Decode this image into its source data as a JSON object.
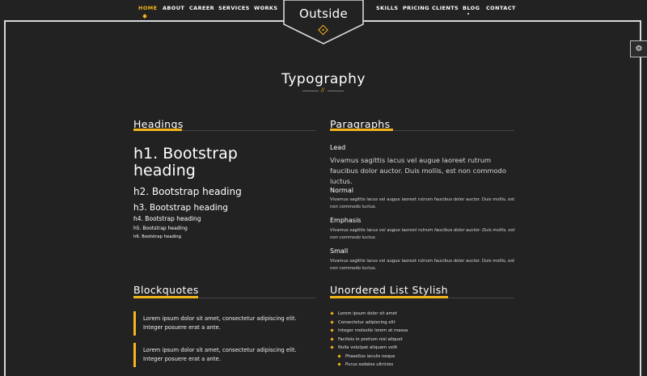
{
  "nav": {
    "left": [
      "HOME",
      "ABOUT",
      "CAREER",
      "SERVICES",
      "WORKS"
    ],
    "right": [
      "SKILLS",
      "PRICING",
      "CLIENTS",
      "BLOG",
      "CONTACT"
    ]
  },
  "logo": {
    "text": "Outside"
  },
  "settings_icon": "gear-icon",
  "page": {
    "title": "Typography",
    "separator": "//"
  },
  "headings_section": {
    "title": "Headings",
    "h1": "h1. Bootstrap heading",
    "h2": "h2. Bootstrap heading",
    "h3": "h3. Bootstrap heading",
    "h4": "h4. Bootstrap heading",
    "h5": "h5. Bootstrap heading",
    "h6": "h6. Bootstrap heading"
  },
  "paragraphs_section": {
    "title": "Paragraphs",
    "lead_label": "Lead",
    "lead_text": "Vivamus sagittis lacus vel augue laoreet rutrum faucibus dolor auctor. Duis mollis, est non commodo luctus.",
    "normal_label": "Normal",
    "normal_text": "Vivamus sagittis lacus vel augue laoreet rutrum faucibus dolor auctor. Duis mollis, est non commodo luctus.",
    "emphasis_label": "Emphasis",
    "emphasis_text": "Vivamus sagittis lacus vel augue laoreet rutrum faucibus dolor auctor. Duis mollis, est non commodo luctus.",
    "small_label": "Small",
    "small_text": "Vivamus sagittis lacus vel augue laoreet rutrum faucibus dolor auctor. Duis mollis, est non commodo luctus."
  },
  "blockquotes_section": {
    "title": "Blockquotes",
    "quotes": [
      "Lorem ipsum dolor sit amet, consectetur adipiscing elit. Integer posuere erat a ante.",
      "Lorem ipsum dolor sit amet, consectetur adipiscing elit. Integer posuere erat a ante."
    ]
  },
  "list_section": {
    "title": "Unordered List Stylish",
    "items": [
      "Lorem ipsum dolor sit amet",
      "Consectetur adipiscing elit",
      "Integer molestie lorem at massa",
      "Facilisis in pretium nisl aliquet",
      "Nulla volutpat aliquam velit",
      "Phasellus iaculis neque",
      "Purus sodales ultricies"
    ]
  },
  "colors": {
    "accent": "#f3b51c",
    "background": "#222222",
    "frame": "#d8d8d8"
  }
}
